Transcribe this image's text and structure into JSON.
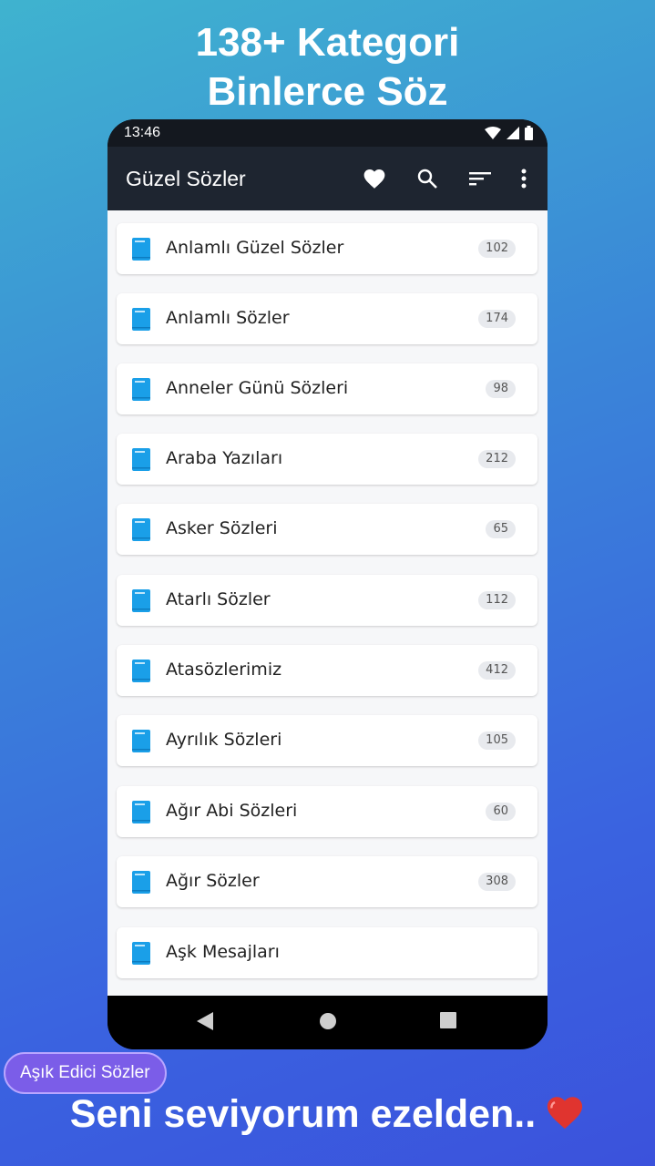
{
  "headline": {
    "line1": "138+ Kategori",
    "line2": "Binlerce Söz"
  },
  "status_bar": {
    "time": "13:46",
    "icons": [
      "wifi-icon",
      "signal-icon",
      "battery-icon"
    ]
  },
  "app_bar": {
    "title": "Güzel Sözler",
    "actions": [
      "heart-icon",
      "search-icon",
      "sort-icon",
      "more-vert-icon"
    ]
  },
  "categories": [
    {
      "label": "Anlamlı Güzel Sözler",
      "count": "102"
    },
    {
      "label": "Anlamlı Sözler",
      "count": "174"
    },
    {
      "label": "Anneler Günü Sözleri",
      "count": "98"
    },
    {
      "label": "Araba Yazıları",
      "count": "212"
    },
    {
      "label": "Asker Sözleri",
      "count": "65"
    },
    {
      "label": "Atarlı Sözler",
      "count": "112"
    },
    {
      "label": "Atasözlerimiz",
      "count": "412"
    },
    {
      "label": "Ayrılık Sözleri",
      "count": "105"
    },
    {
      "label": "Ağır Abi Sözleri",
      "count": "60"
    },
    {
      "label": "Ağır Sözler",
      "count": "308"
    },
    {
      "label": "Aşk Mesajları",
      "count": ""
    }
  ],
  "fab": {
    "icon": "feather-icon"
  },
  "navbar": {
    "icons": [
      "back-icon",
      "home-icon",
      "recents-icon"
    ]
  },
  "chip": {
    "label": "Aşık Edici Sözler"
  },
  "slogan": {
    "text": "Seni seviyorum ezelden.."
  },
  "colors": {
    "accent": "#1ea1f1",
    "appbar": "#1e2530",
    "chip": "#7b5de8",
    "heart": "#e0342f"
  }
}
